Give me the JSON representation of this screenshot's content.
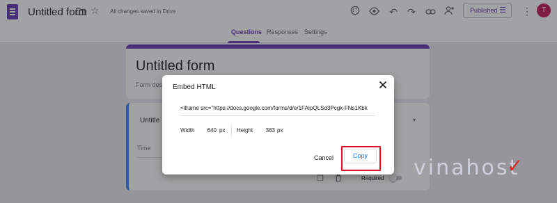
{
  "header": {
    "doc_title": "Untitled form",
    "save_status": "All changes saved in Drive",
    "published_label": "Published",
    "avatar_letter": "T",
    "tabs": [
      {
        "label": "Questions",
        "active": true
      },
      {
        "label": "Responses",
        "active": false
      },
      {
        "label": "Settings",
        "active": false
      }
    ],
    "icons": [
      "forms-logo-icon",
      "folder-icon",
      "star-icon",
      "palette-icon",
      "preview-eye-icon",
      "undo-icon",
      "redo-icon",
      "link-icon",
      "add-collaborator-icon",
      "tune-icon",
      "more-vert-icon"
    ]
  },
  "form": {
    "title": "Untitled form",
    "description_partial": "Form desc",
    "question_title_partial": "Untitle",
    "answer_hint": "Time",
    "required_label": "Required"
  },
  "dialog": {
    "title": "Embed HTML",
    "embed_code": "<iframe src=\"https://docs.google.com/forms/d/e/1FAIpQLSd3Pcgk-FNs1Kbk",
    "width_label": "Width",
    "width_value": "640",
    "height_label": "Height",
    "height_value": "383",
    "unit": "px",
    "cancel_label": "Cancel",
    "copy_label": "Copy"
  },
  "colors": {
    "brand_purple": "#673ab7",
    "accent_blue": "#1a73e8",
    "highlight_red": "#e0102a"
  },
  "watermark": {
    "text": "vinahost"
  }
}
